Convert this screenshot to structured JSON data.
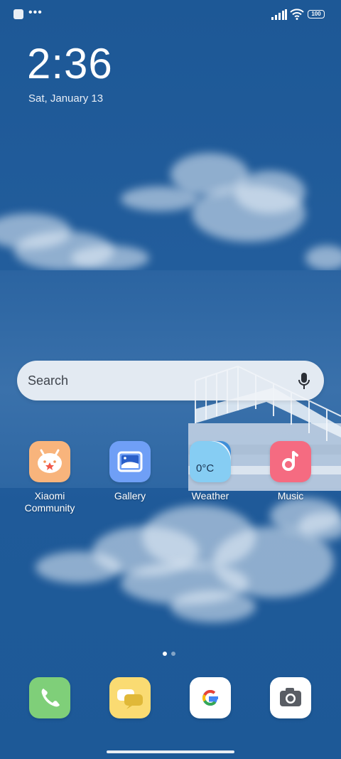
{
  "status_bar": {
    "notification_icons": [
      "app-notification-icon",
      "more-notifications-icon"
    ],
    "battery_level": "100",
    "signal_icon": "cellular-signal-icon",
    "wifi_icon": "wifi-icon"
  },
  "clock": {
    "time": "2:36",
    "date": "Sat, January 13"
  },
  "search": {
    "placeholder": "Search",
    "mic_icon": "microphone-icon"
  },
  "apps": [
    {
      "label": "Xiaomi\nCommunity",
      "icon": "xiaomi-community-icon",
      "color": "#f7b27a"
    },
    {
      "label": "Gallery",
      "icon": "gallery-icon",
      "color": "#6f9ef5"
    },
    {
      "label": "Weather",
      "icon": "weather-icon",
      "temp": "0°C",
      "color": "#7cc6f0"
    },
    {
      "label": "Music",
      "icon": "music-icon",
      "color": "#f2687e"
    }
  ],
  "page_indicator": {
    "current": 1,
    "total": 2
  },
  "dock": [
    {
      "name": "Phone",
      "icon": "phone-icon",
      "color": "#7fd07a"
    },
    {
      "name": "Messages",
      "icon": "messages-icon",
      "color": "#f9d86a"
    },
    {
      "name": "Google",
      "icon": "google-icon",
      "color": "#ffffff"
    },
    {
      "name": "Camera",
      "icon": "camera-icon",
      "color": "#ffffff"
    }
  ]
}
